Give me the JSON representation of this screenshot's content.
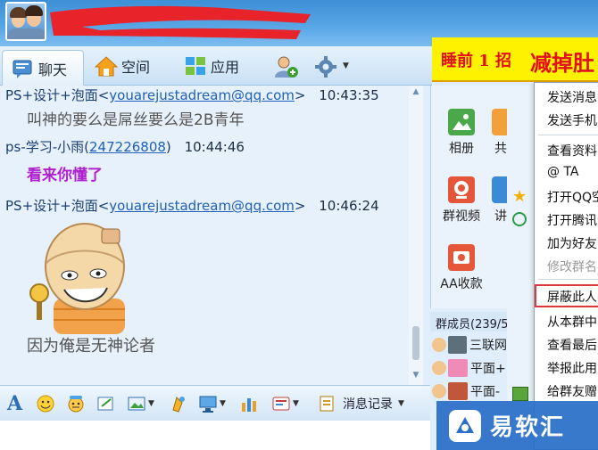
{
  "nav": {
    "tabs": [
      {
        "label": "聊天",
        "icon": "chat-icon",
        "active": true
      },
      {
        "label": "空间",
        "icon": "home-icon"
      },
      {
        "label": "应用",
        "icon": "apps-grid-icon"
      }
    ],
    "extra_icons": [
      "add-member-icon",
      "settings-gear-icon"
    ]
  },
  "banner": {
    "text1": "睡前 1 招",
    "text2": "减掉肚"
  },
  "chat": {
    "messages": [
      {
        "sender": "PS+设计+泡面<",
        "email": "youarejustadream@qq.com",
        "suffix": ">",
        "time": "10:43:35",
        "body": "叫神的要么是屌丝要么是2B青年",
        "body_color": "#555555"
      },
      {
        "sender": "ps-学习-小雨(",
        "email": "247226808",
        "suffix": ")",
        "time": "10:44:46",
        "body": "看来你懂了",
        "body_color": "#b020d0"
      },
      {
        "sender": "PS+设计+泡面<",
        "email": "youarejustadream@qq.com",
        "suffix": ">",
        "time": "10:46:24",
        "body": "因为俺是无神论者",
        "body_color": "#555555"
      }
    ]
  },
  "toolbar": {
    "items": [
      "font-icon",
      "emoji-icon",
      "magic-face-icon",
      "screenshot-icon",
      "image-icon",
      "shake-icon",
      "screen-share-icon",
      "doc-icon",
      "voice-icon"
    ],
    "history_label": "消息记录"
  },
  "apps": [
    {
      "label": "相册",
      "icon": "album-icon"
    },
    {
      "label": "共",
      "icon": "share-icon"
    },
    {
      "label": "群视频",
      "icon": "group-video-icon"
    },
    {
      "label": "讲",
      "icon": "lecture-icon"
    },
    {
      "label": "AA收款",
      "icon": "aa-payment-icon"
    }
  ],
  "members": {
    "header": "群成员(239/5",
    "items": [
      {
        "name": "三联网"
      },
      {
        "name": "平面+"
      },
      {
        "name": "平面-"
      }
    ]
  },
  "context_menu": {
    "items": [
      {
        "label": "发送消息"
      },
      {
        "label": "发送手机"
      },
      {
        "label": "查看资料"
      },
      {
        "label": "@ TA"
      },
      {
        "label": "打开QQ空"
      },
      {
        "label": "打开腾讯"
      },
      {
        "label": "加为好友"
      },
      {
        "label": "修改群名",
        "disabled": true
      },
      {
        "label": "屏蔽此人",
        "highlight": true
      },
      {
        "label": "从本群中"
      },
      {
        "label": "查看最后"
      },
      {
        "label": "举报此用"
      },
      {
        "label": "给群友赠"
      }
    ]
  },
  "watermark": {
    "text": "易软汇"
  }
}
